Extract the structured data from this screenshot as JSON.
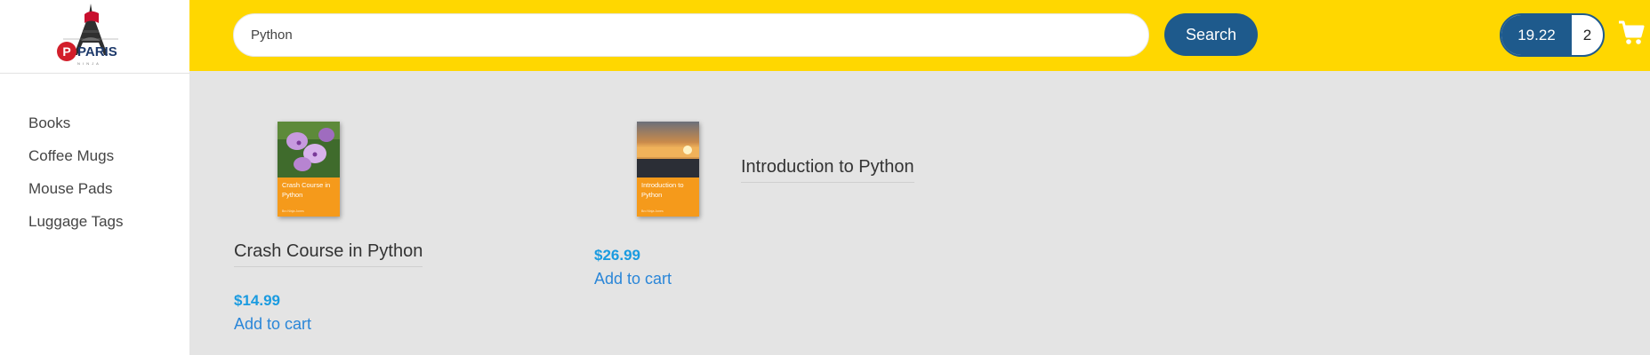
{
  "brand": {
    "logo_text": "PARIS",
    "logo_subtext": "N I N J A"
  },
  "sidebar": {
    "items": [
      {
        "label": "Books"
      },
      {
        "label": "Coffee Mugs"
      },
      {
        "label": "Mouse Pads"
      },
      {
        "label": "Luggage Tags"
      }
    ]
  },
  "header": {
    "search": {
      "value": "Python",
      "placeholder": ""
    },
    "search_button_label": "Search",
    "cart": {
      "total": "19.22",
      "count": "2",
      "icon": "cart-icon"
    }
  },
  "colors": {
    "header_bg": "#ffd700",
    "accent": "#1e5a8c",
    "price": "#1a9be0",
    "link": "#2a86d8",
    "cover_band": "#f59a1b"
  },
  "products": [
    {
      "title": "Crash Course in Python",
      "cover_title": "Crash Course in Python",
      "cover_author": "Bro Ninja Jones",
      "price": "$14.99",
      "add_to_cart": "Add to cart"
    },
    {
      "title": "Introduction to Python",
      "cover_title": "Introduction to Python",
      "cover_author": "Bro Ninja Jones",
      "price": "$26.99",
      "add_to_cart": "Add to cart"
    }
  ]
}
